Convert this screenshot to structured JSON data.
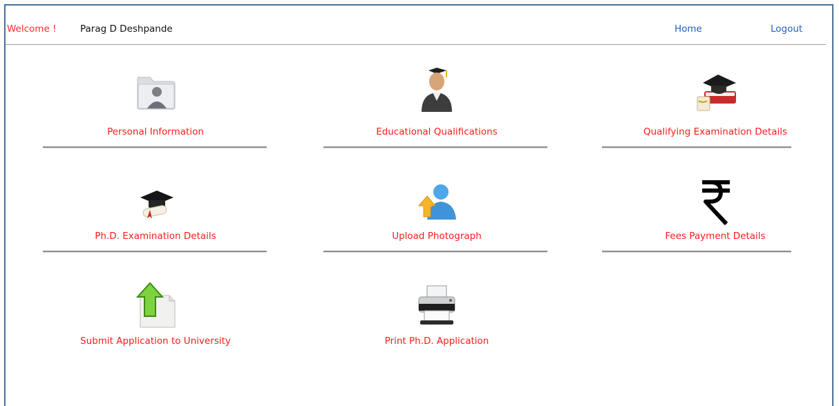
{
  "header": {
    "welcome": "Welcome !",
    "user_name": "Parag D Deshpande",
    "home_label": "Home",
    "logout_label": "Logout"
  },
  "tiles": [
    {
      "label": "Personal Information",
      "icon": "folder-user-icon"
    },
    {
      "label": "Educational Qualifications",
      "icon": "graduate-icon"
    },
    {
      "label": "Qualifying Examination Details",
      "icon": "cap-books-icon"
    },
    {
      "label": "Ph.D. Examination Details",
      "icon": "cap-diploma-icon"
    },
    {
      "label": "Upload Photograph",
      "icon": "upload-user-icon"
    },
    {
      "label": "Fees Payment Details",
      "icon": "rupee-icon"
    },
    {
      "label": "Submit Application to University",
      "icon": "upload-document-icon"
    },
    {
      "label": "Print Ph.D. Application",
      "icon": "printer-icon"
    }
  ],
  "colors": {
    "accent_red": "#ff1a1a",
    "link_blue": "#1f5fbf",
    "frame_blue": "#4a6f96"
  }
}
